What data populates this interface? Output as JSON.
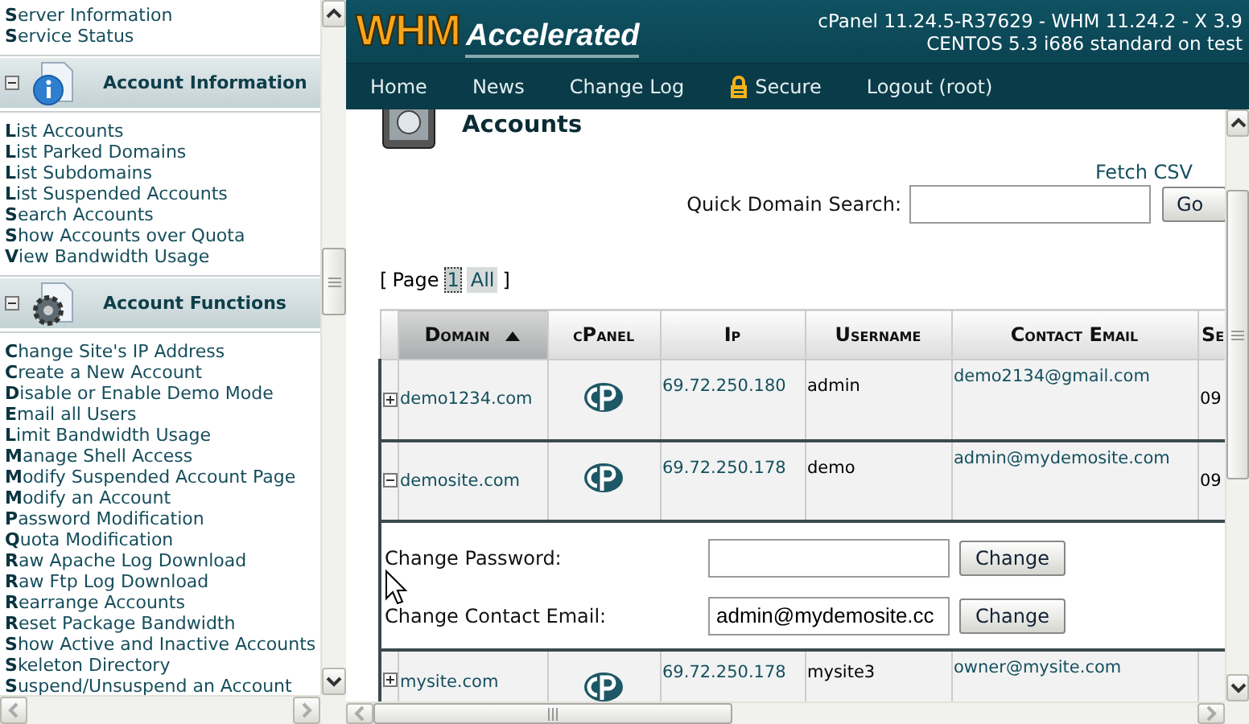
{
  "sidebar": {
    "top_items": [
      "**S**erver Information",
      "**S**ervice Status"
    ],
    "sections": [
      {
        "title": "Account Information",
        "expanded": true,
        "items": [
          "**L**ist Accounts",
          "**L**ist Parked Domains",
          "**L**ist Subdomains",
          "**L**ist Suspended Accounts",
          "**S**earch Accounts",
          "**S**how Accounts over Quota",
          "**V**iew Bandwidth Usage"
        ]
      },
      {
        "title": "Account Functions",
        "expanded": true,
        "items": [
          "**C**hange Site's IP Address",
          "**C**reate a New Account",
          "**D**isable or Enable Demo Mode",
          "**E**mail all Users",
          "**L**imit Bandwidth Usage",
          "**M**anage Shell Access",
          "**M**odify Suspended Account Page",
          "**M**odify an Account",
          "**P**assword Modification",
          "**Q**uota Modification",
          "**R**aw Apache Log Download",
          "**R**aw Ftp Log Download",
          "**R**earrange Accounts",
          "**R**eset Package Bandwidth",
          "**S**how Active and Inactive Accounts",
          "**S**keleton Directory",
          "**S**uspend/Unsuspend an Account"
        ]
      }
    ]
  },
  "header": {
    "logo_primary": "WHM",
    "logo_secondary": "Accelerated",
    "version_lines": [
      "cPanel 11.24.5-R37629 - WHM 11.24.2 - X 3.9",
      "CENTOS 5.3 i686 standard on test"
    ]
  },
  "nav": [
    {
      "label": "Home",
      "kind": "link"
    },
    {
      "label": "News",
      "kind": "link"
    },
    {
      "label": "Change Log",
      "kind": "link"
    },
    {
      "label": "Secure",
      "kind": "lock"
    },
    {
      "label": "Logout (root)",
      "kind": "link"
    }
  ],
  "page": {
    "title": "Accounts",
    "fetch_csv": "Fetch CSV",
    "quick_search": {
      "label": "Quick Domain Search:",
      "button": "Go"
    },
    "pager": {
      "open": "[",
      "label": "Page",
      "pages": [
        {
          "label": "1",
          "selected": true
        },
        {
          "label": "All",
          "selected": false
        }
      ],
      "close": "]"
    },
    "table": {
      "columns": [
        {
          "label": "Domain",
          "sorted": true
        },
        {
          "label": "cPanel",
          "sorted": false
        },
        {
          "label": "Ip",
          "sorted": false
        },
        {
          "label": "Username",
          "sorted": false
        },
        {
          "label": "Contact Email",
          "sorted": false
        },
        {
          "label": "Se",
          "sorted": false
        }
      ],
      "rows": [
        {
          "expanded": false,
          "domain": "demo1234.com",
          "ip": "69.72.250.180",
          "username": "admin",
          "email": "demo2134@gmail.com",
          "column_6": "09"
        },
        {
          "expanded": true,
          "domain": "demosite.com",
          "ip": "69.72.250.178",
          "username": "demo",
          "email": "admin@mydemosite.com",
          "column_6": "09",
          "details": [
            {
              "label": "Change Password:",
              "button": "Change"
            },
            {
              "label": "Change Contact Email:",
              "value": "admin@mydemosite.cc",
              "button": "Change"
            }
          ]
        },
        {
          "expanded": false,
          "domain": "mysite.com",
          "ip": "69.72.250.178",
          "username": "mysite3",
          "email": "owner@mysite.com"
        }
      ]
    }
  }
}
